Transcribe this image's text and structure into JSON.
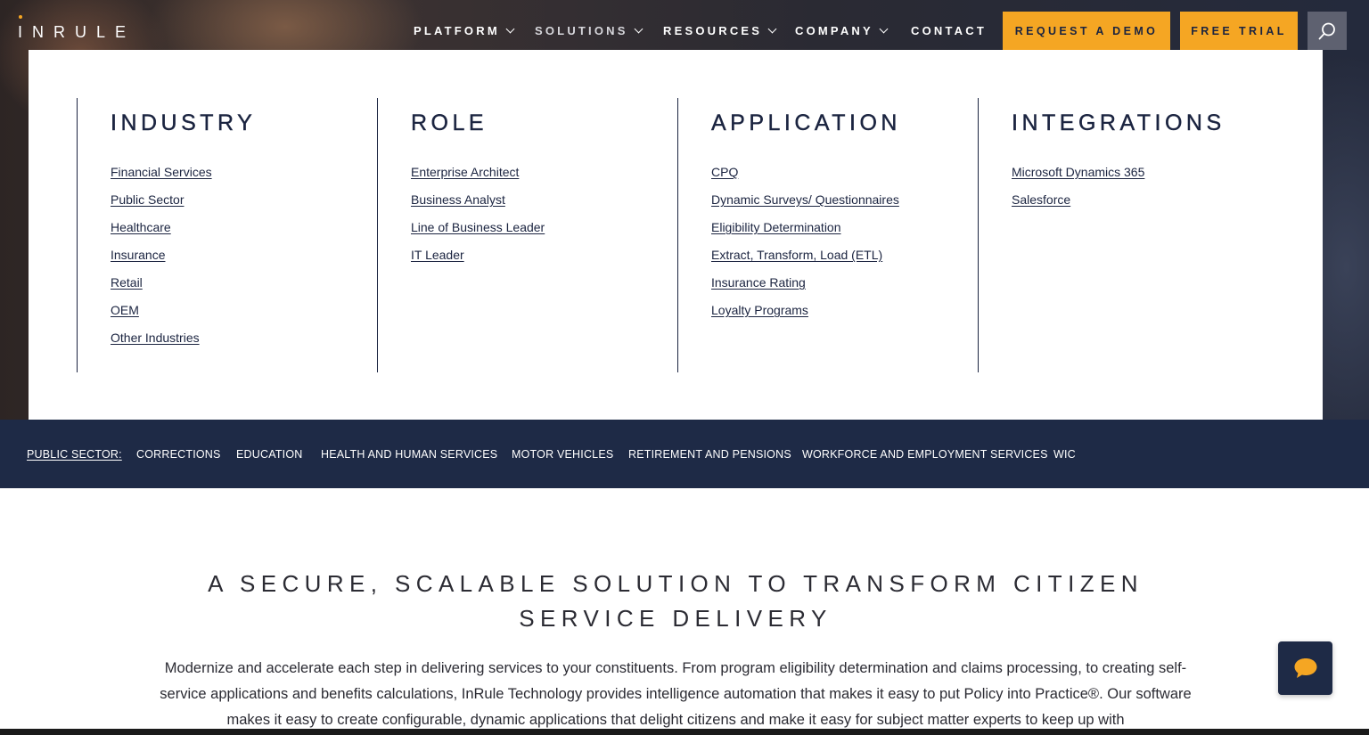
{
  "header": {
    "logo_text": "INRULE",
    "nav": [
      {
        "label": "PLATFORM"
      },
      {
        "label": "SOLUTIONS"
      },
      {
        "label": "RESOURCES"
      },
      {
        "label": "COMPANY"
      },
      {
        "label": "CONTACT"
      }
    ],
    "demo_label": "REQUEST A DEMO",
    "trial_label": "FREE TRIAL",
    "search_icon": "search-icon"
  },
  "mega_menu": {
    "columns": [
      {
        "title": "INDUSTRY",
        "links": [
          "Financial Services",
          "Public Sector",
          "Healthcare",
          "Insurance",
          "Retail",
          "OEM",
          "Other Industries"
        ]
      },
      {
        "title": "ROLE",
        "links": [
          "Enterprise Architect",
          "Business Analyst",
          "Line of Business Leader",
          "IT Leader"
        ]
      },
      {
        "title": "APPLICATION",
        "links": [
          "CPQ",
          "Dynamic Surveys/ Questionnaires",
          "Eligibility Determination",
          "Extract, Transform, Load (ETL)",
          "Insurance Rating",
          "Loyalty Programs"
        ]
      },
      {
        "title": "INTEGRATIONS",
        "links": [
          "Microsoft Dynamics 365",
          "Salesforce"
        ]
      }
    ]
  },
  "subnav": {
    "lead": "PUBLIC SECTOR:",
    "items": [
      "CORRECTIONS",
      "EDUCATION",
      "HEALTH AND HUMAN SERVICES",
      "MOTOR VEHICLES",
      "RETIREMENT AND PENSIONS",
      "WORKFORCE AND EMPLOYMENT SERVICES",
      "WIC"
    ]
  },
  "main": {
    "headline": "A SECURE, SCALABLE SOLUTION TO TRANSFORM CITIZEN SERVICE DELIVERY",
    "body": "Modernize and accelerate each step in delivering services to your constituents. From program eligibility determination and claims processing, to creating self-service applications and benefits calculations, InRule Technology provides intelligence automation that makes it easy to put Policy into Practice®. Our software makes it easy to create configurable, dynamic applications that delight citizens and make it easy for subject matter experts to keep up with"
  },
  "chat": {
    "icon": "chat-bubble-icon"
  },
  "colors": {
    "accent": "#f5a623",
    "navy": "#1e2a46",
    "text": "#1b2440"
  }
}
